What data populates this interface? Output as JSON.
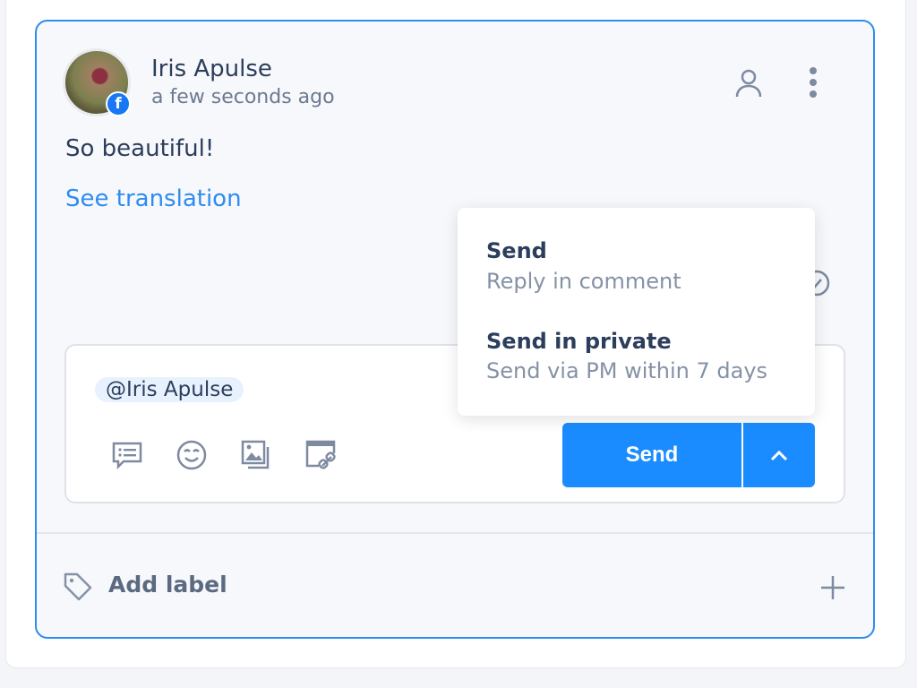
{
  "comment": {
    "author": "Iris Apulse",
    "time": "a few seconds ago",
    "text": "So beautiful!",
    "translate_link": "See translation",
    "source_icon": "facebook-icon"
  },
  "reply": {
    "mention": "@Iris Apulse",
    "send_label": "Send"
  },
  "send_menu": [
    {
      "title": "Send",
      "subtitle": "Reply in comment"
    },
    {
      "title": "Send in private",
      "subtitle": "Send via PM within 7 days"
    }
  ],
  "footer": {
    "add_label": "Add label"
  },
  "colors": {
    "accent": "#1a8cff",
    "border": "#2d8cf0",
    "text": "#2c3e5c"
  }
}
